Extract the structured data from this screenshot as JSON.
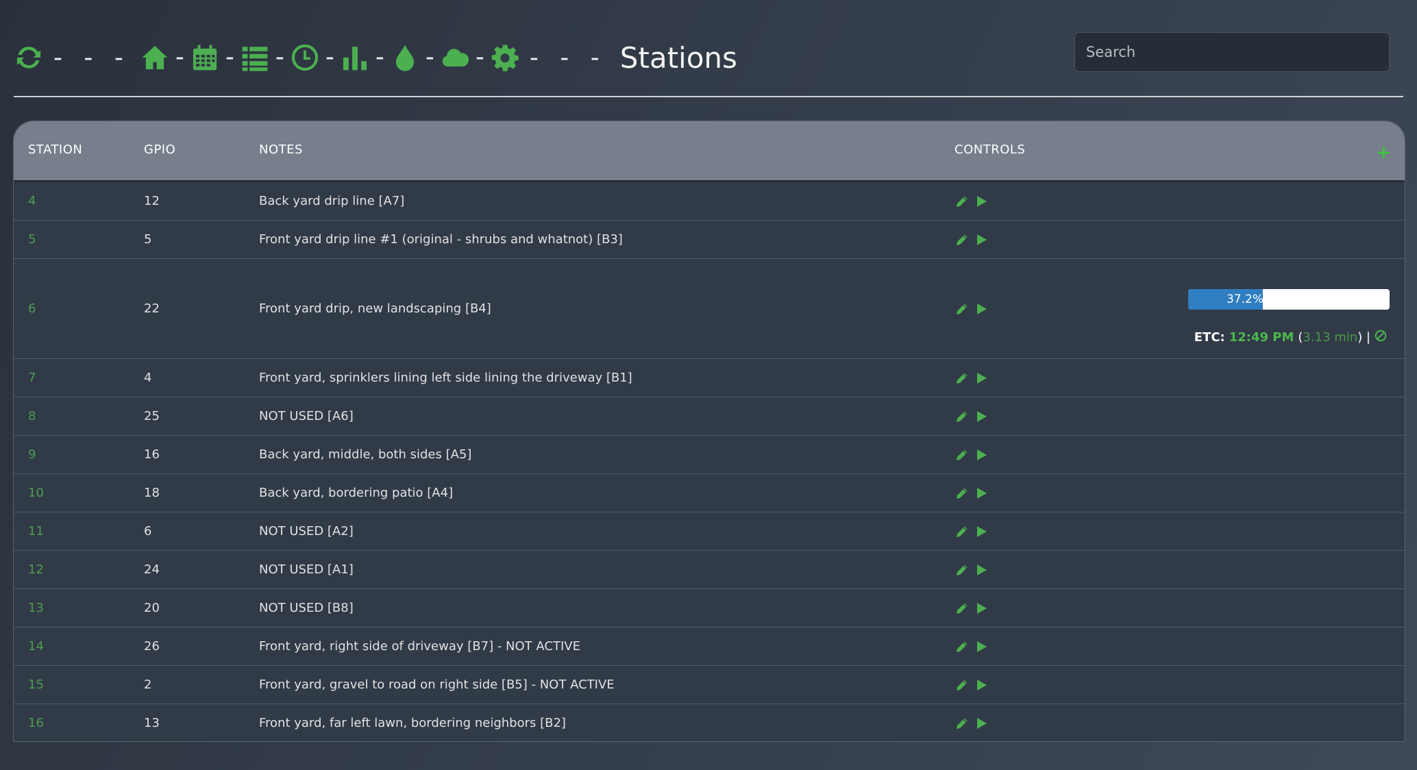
{
  "header": {
    "title": "Stations",
    "nav_icons": [
      "refresh-icon",
      "home-icon",
      "calendar-icon",
      "list-icon",
      "clock-icon",
      "bar-chart-icon",
      "droplet-icon",
      "cloud-icon",
      "gear-icon"
    ],
    "search_placeholder": "Search"
  },
  "table": {
    "columns": {
      "station": "STATION",
      "gpio": "GPIO",
      "notes": "NOTES",
      "controls": "CONTROLS"
    },
    "add_icon": "plus-icon",
    "rows": [
      {
        "station": "4",
        "gpio": "12",
        "notes": "Back yard drip line [A7]"
      },
      {
        "station": "5",
        "gpio": "5",
        "notes": "Front yard drip line #1 (original - shrubs and whatnot) [B3]"
      },
      {
        "station": "6",
        "gpio": "22",
        "notes": "Front yard drip, new landscaping [B4]"
      },
      {
        "station": "7",
        "gpio": "4",
        "notes": "Front yard, sprinklers lining left side lining the driveway [B1]"
      },
      {
        "station": "8",
        "gpio": "25",
        "notes": "NOT USED [A6]"
      },
      {
        "station": "9",
        "gpio": "16",
        "notes": "Back yard, middle, both sides [A5]"
      },
      {
        "station": "10",
        "gpio": "18",
        "notes": "Back yard, bordering patio [A4]"
      },
      {
        "station": "11",
        "gpio": "6",
        "notes": "NOT USED [A2]"
      },
      {
        "station": "12",
        "gpio": "24",
        "notes": "NOT USED [A1]"
      },
      {
        "station": "13",
        "gpio": "20",
        "notes": "NOT USED [B8]"
      },
      {
        "station": "14",
        "gpio": "26",
        "notes": "Front yard, right side of driveway [B7] - NOT ACTIVE"
      },
      {
        "station": "15",
        "gpio": "2",
        "notes": "Front yard, gravel to road on right side [B5] - NOT ACTIVE"
      },
      {
        "station": "16",
        "gpio": "13",
        "notes": "Front yard, far left lawn, bordering neighbors [B2]"
      }
    ],
    "running": {
      "station": "6",
      "progress_fraction": 0.372,
      "progress_label": "37.2%",
      "etc_label": "ETC:",
      "etc_time": "12:49 PM",
      "etc_duration": "3.13 min",
      "open_paren": "(",
      "close_paren_sep": ") |"
    }
  },
  "colors": {
    "accent_green": "#4cb84c",
    "progress_blue": "#2f7ec2",
    "header_gray": "#767f8b"
  }
}
